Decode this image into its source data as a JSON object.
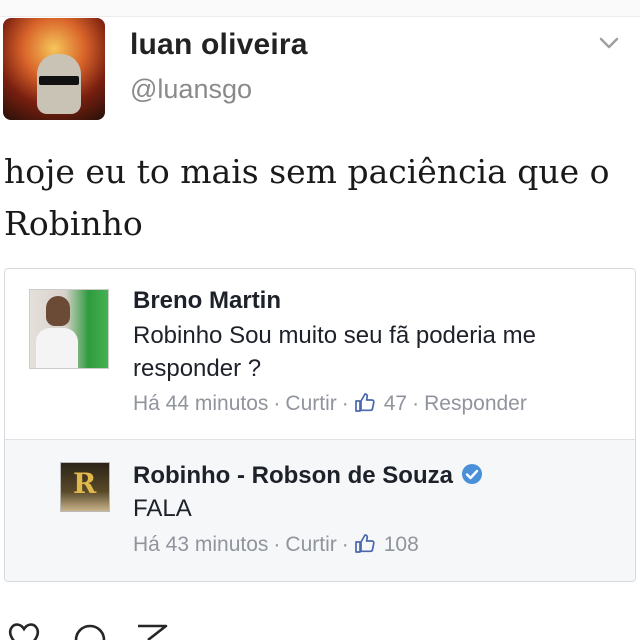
{
  "header": {
    "display_name": "luan oliveira",
    "handle": "@luansgo"
  },
  "tweet": {
    "text": "hoje eu to mais sem paciência que o Robinho"
  },
  "comments": [
    {
      "name": "Breno Martin",
      "text": "Robinho Sou muito seu fã poderia me responder ?",
      "time": "Há 44 minutos",
      "like_label": "Curtir",
      "like_count": "47",
      "reply_label": "Responder"
    },
    {
      "name": "Robinho - Robson de Souza",
      "text": "FALA",
      "time": "Há 43 minutos",
      "like_label": "Curtir",
      "like_count": "108",
      "verified": true
    }
  ],
  "icons": {
    "menu": "chevron-down-icon",
    "like": "thumbs-up-icon",
    "verified": "verified-badge-icon",
    "bottom_bar": [
      "heart-icon",
      "comment-icon",
      "share-icon"
    ]
  },
  "colors": {
    "verified_blue": "#4a90d9",
    "meta_gray": "#90949c",
    "like_blue": "#4a67ad"
  }
}
